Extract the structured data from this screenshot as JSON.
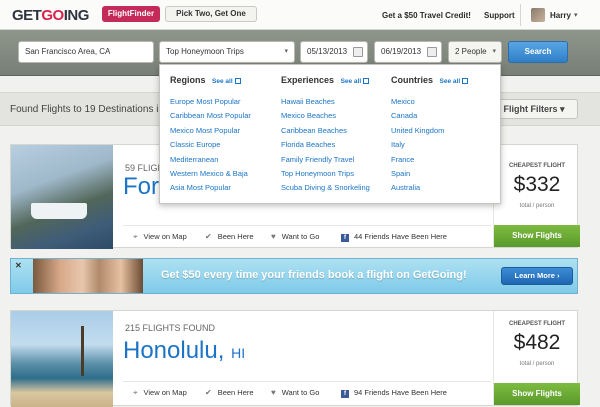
{
  "nav": {
    "logo_part1": "GET",
    "logo_part2": "GO",
    "logo_part3": "ING",
    "flightfinder_label": "FlightFinder",
    "picktwo_label": "Pick Two, Get One",
    "credit_label": "Get a $50 Travel Credit!",
    "support_label": "Support",
    "user_name": "Harry",
    "caret": "▾"
  },
  "search": {
    "location_value": "San Francisco Area, CA",
    "trip_type_value": "Top Honeymoon Trips",
    "depart_date": "05/13/2013",
    "return_date": "06/19/2013",
    "people_value": "2 People",
    "search_label": "Search",
    "dropdown_glyph": "▾"
  },
  "subheader": {
    "found_text": "Found Flights to 19 Destinations in",
    "filters_label": "Flight Filters",
    "filters_glyph": "▾"
  },
  "dropdown": {
    "see_all_label": "See all",
    "regions": {
      "title": "Regions",
      "items": [
        "Europe Most Popular",
        "Caribbean Most Popular",
        "Mexico Most Popular",
        "Classic Europe",
        "Mediterranean",
        "Western Mexico & Baja",
        "Asia Most Popular"
      ]
    },
    "experiences": {
      "title": "Experiences",
      "items": [
        "Hawaii Beaches",
        "Mexico Beaches",
        "Caribbean Beaches",
        "Florida Beaches",
        "Family Friendly Travel",
        "Top Honeymoon Trips",
        "Scuba Diving & Snorkeling"
      ]
    },
    "countries": {
      "title": "Countries",
      "items": [
        "Mexico",
        "Canada",
        "United Kingdom",
        "Italy",
        "France",
        "Spain",
        "Australia"
      ]
    }
  },
  "cards": [
    {
      "flights_found": "59 FLIGH",
      "city": "For",
      "state": "",
      "cheapest_label": "CHEAPEST FLIGHT",
      "price": "$332",
      "per_person": "total / person",
      "view_map": "View on Map",
      "been_here": "Been Here",
      "want_to_go": "Want to Go",
      "friends": "44 Friends Have Been Here",
      "show_flights": "Show Flights"
    },
    {
      "flights_found": "215 FLIGHTS FOUND",
      "city": "Honolulu,",
      "state": "HI",
      "cheapest_label": "CHEAPEST FLIGHT",
      "price": "$482",
      "per_person": "total / person",
      "view_map": "View on Map",
      "been_here": "Been Here",
      "want_to_go": "Want to Go",
      "friends": "94 Friends Have Been Here",
      "show_flights": "Show Flights"
    }
  ],
  "promo": {
    "close": "✕",
    "text": "Get $50 every time your friends book a flight on GetGoing!",
    "learn_more": "Learn More ›"
  },
  "icons": {
    "map_pin": "⌖",
    "check": "✔",
    "heart": "♥",
    "facebook": "f"
  }
}
